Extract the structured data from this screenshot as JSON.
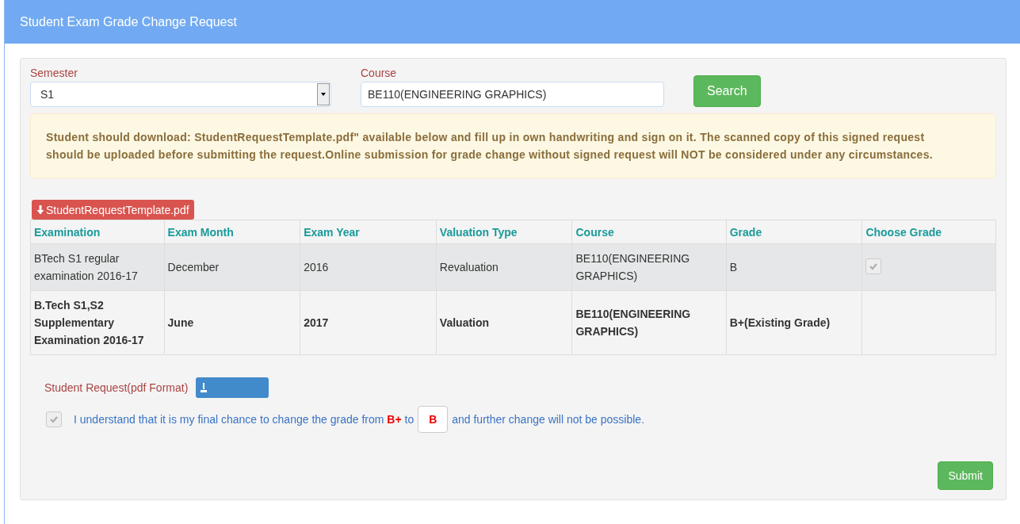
{
  "header": {
    "title": "Student Exam Grade Change Request"
  },
  "filters": {
    "semester": {
      "label": "Semester",
      "value": "S1"
    },
    "course": {
      "label": "Course",
      "value": "BE110(ENGINEERING GRAPHICS)"
    },
    "search_button": "Search"
  },
  "notice": "Student should download: StudentRequestTemplate.pdf\" available below and fill up in own handwriting and sign on it. The scanned copy of this signed request should be uploaded before submitting the request.Online submission for grade change without signed request will NOT be considered under any circumstances.",
  "template_button": "StudentRequestTemplate.pdf",
  "table": {
    "columns": [
      "Examination",
      "Exam Month",
      "Exam Year",
      "Valuation Type",
      "Course",
      "Grade",
      "Choose Grade"
    ],
    "rows": [
      {
        "kind": "option",
        "selected": true,
        "cells": [
          "BTech S1 regular examination 2016-17",
          "December",
          "2016",
          "Revaluation",
          "BE110(ENGINEERING GRAPHICS)",
          "B"
        ],
        "checked": true,
        "disabled": true
      },
      {
        "kind": "existing",
        "selected": false,
        "cells": [
          "B.Tech S1,S2 Supplementary Examination 2016-17",
          "June",
          "2017",
          "Valuation",
          "BE110(ENGINEERING GRAPHICS)",
          "B+(Existing Grade)"
        ]
      }
    ]
  },
  "upload": {
    "label": "Student Request(pdf Format)"
  },
  "consent": {
    "checked": true,
    "disabled": true,
    "text": "I understand that it is my final chance to change the grade from **B+** to",
    "new_grade": "B",
    "text_after": "and further change will not be possible."
  },
  "submit_button": "Submit"
}
